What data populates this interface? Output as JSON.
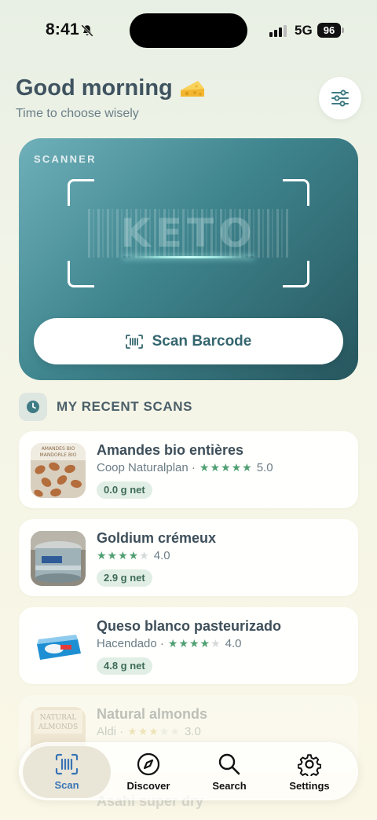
{
  "status_bar": {
    "time": "8:41",
    "network": "5G",
    "battery": "96"
  },
  "header": {
    "greeting": "Good morning",
    "subtitle": "Time to choose wisely"
  },
  "scanner": {
    "label": "SCANNER",
    "watermark": "KETO",
    "button_label": "Scan Barcode"
  },
  "recent": {
    "title": "MY RECENT SCANS",
    "items": [
      {
        "name": "Amandes bio entières",
        "brand": "Coop Naturalplan",
        "rating": "5.0",
        "stars": 5,
        "carbs": "0.0 g net"
      },
      {
        "name": "Goldium crémeux",
        "brand": "",
        "rating": "4.0",
        "stars": 4,
        "carbs": "2.9 g net"
      },
      {
        "name": "Queso blanco pasteurizado",
        "brand": "Hacendado",
        "rating": "4.0",
        "stars": 4,
        "carbs": "4.8 g net"
      },
      {
        "name": "Natural almonds",
        "brand": "Aldi",
        "rating": "3.0",
        "stars": 3,
        "carbs": ""
      }
    ],
    "partial_item": "Asahi super dry"
  },
  "tabs": [
    {
      "label": "Scan",
      "icon": "barcode-scan-icon",
      "active": true
    },
    {
      "label": "Discover",
      "icon": "compass-icon",
      "active": false
    },
    {
      "label": "Search",
      "icon": "search-icon",
      "active": false
    },
    {
      "label": "Settings",
      "icon": "gear-icon",
      "active": false
    }
  ],
  "colors": {
    "accent_teal": "#3f858e",
    "star_green": "#4f9f72",
    "active_tab": "#3a74b5"
  }
}
